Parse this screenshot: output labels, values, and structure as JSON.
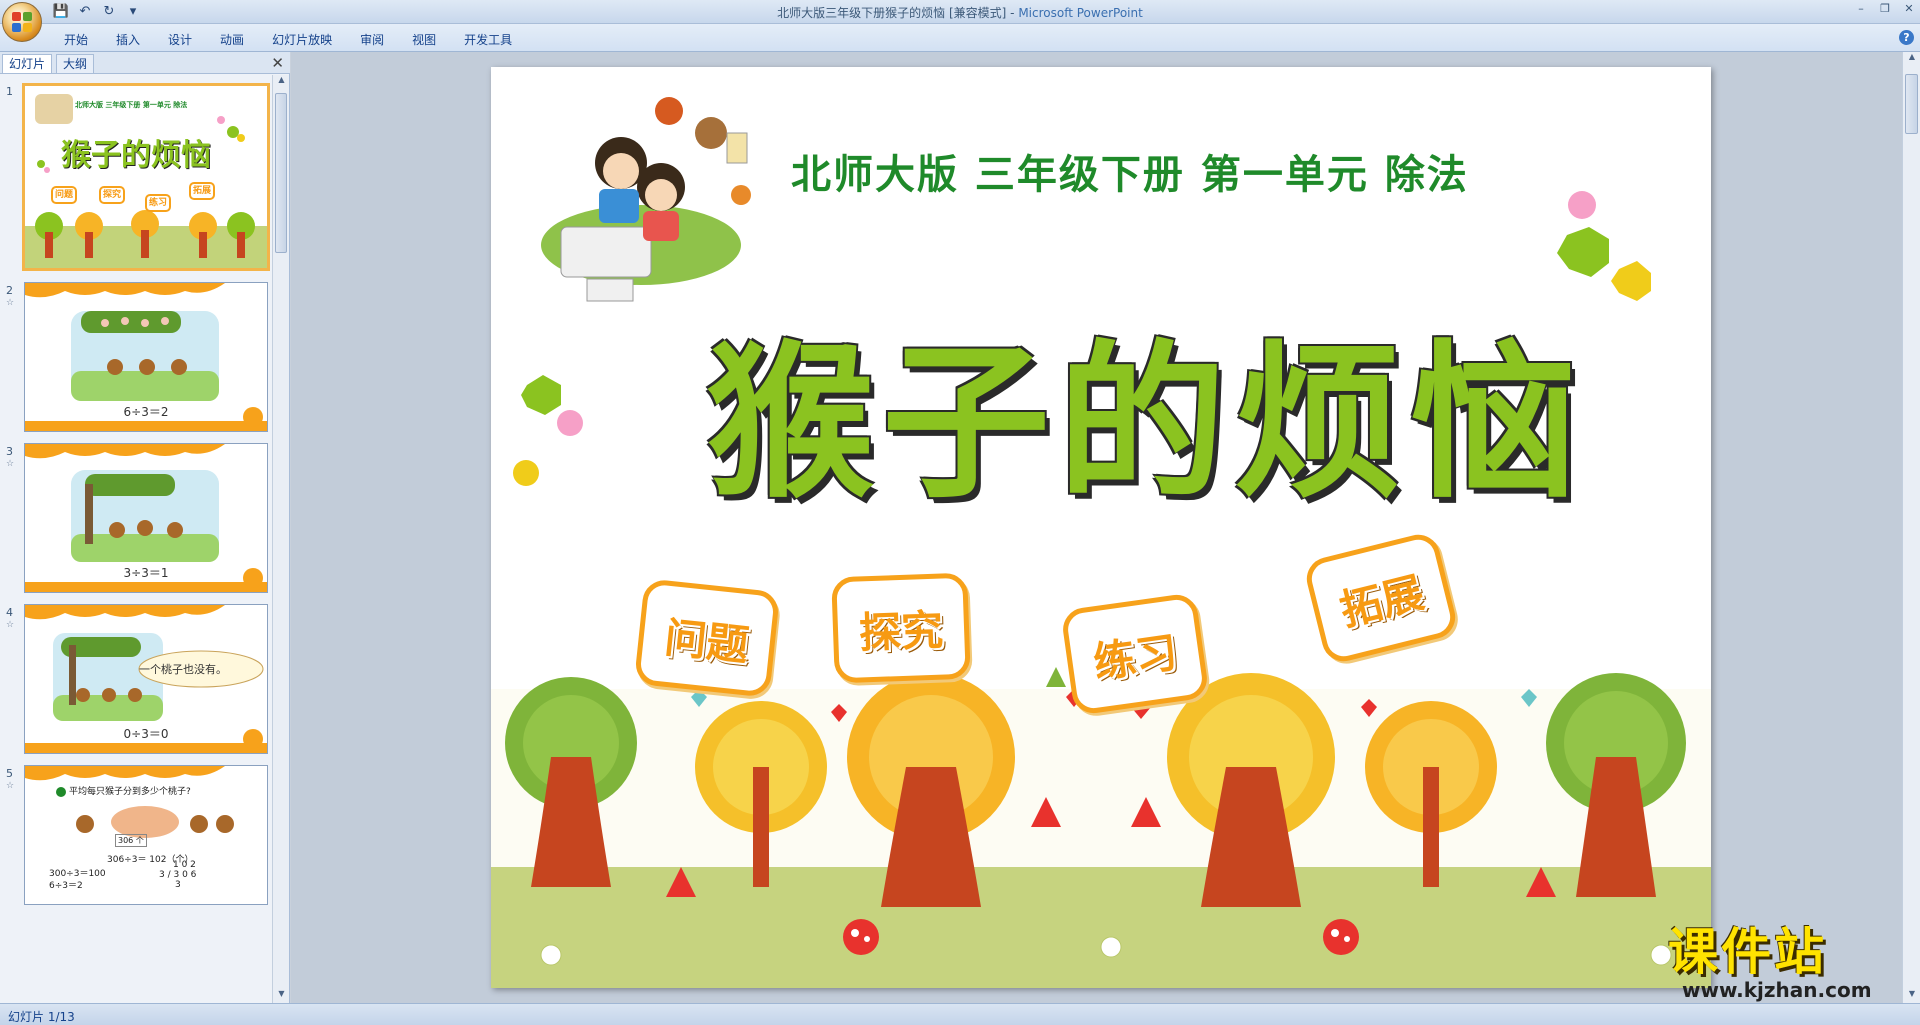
{
  "window": {
    "title": "北师大版三年级下册猴子的烦恼 [兼容模式] - ",
    "app_name": "Microsoft PowerPoint"
  },
  "ribbon": {
    "tabs": [
      "开始",
      "插入",
      "设计",
      "动画",
      "幻灯片放映",
      "审阅",
      "视图",
      "开发工具"
    ]
  },
  "panel": {
    "tab_slides": "幻灯片",
    "tab_outline": "大纲",
    "close": "✕"
  },
  "thumbnails": [
    {
      "num": "1",
      "caption": "",
      "title": "猴子的烦恼",
      "subtitle": "北师大版  三年级下册  第一单元  除法",
      "buttons": [
        "问题",
        "探究",
        "练习",
        "拓展"
      ]
    },
    {
      "num": "2",
      "caption": "6÷3＝2"
    },
    {
      "num": "3",
      "caption": "3÷3＝1"
    },
    {
      "num": "4",
      "caption": "0÷3＝0",
      "bubble": "一个桃子也没有。"
    },
    {
      "num": "5",
      "header": "平均每只猴子分到多少个桃子?",
      "label_306": "306 个",
      "eq1": "306÷3＝   102（个）",
      "eq2": "300÷3＝100",
      "eq3": "6÷3＝2",
      "div_top": "1 0 2",
      "div_mid": "3 / 3 0 6",
      "div_bot": "3"
    }
  ],
  "slide": {
    "subtitle": "北师大版  三年级下册  第一单元  除法",
    "title": "猴子的烦恼",
    "buttons": [
      "问题",
      "探究",
      "练习",
      "拓展"
    ]
  },
  "status": {
    "slide_indicator": "幻灯片 1/13"
  },
  "watermark": {
    "line1": "课件站",
    "line2": "www.kjzhan.com"
  },
  "colors": {
    "title_green": "#8bc320",
    "subtitle_green": "#1f8a2a",
    "badge_orange": "#f79a12",
    "ribbon_text": "#15428b"
  }
}
